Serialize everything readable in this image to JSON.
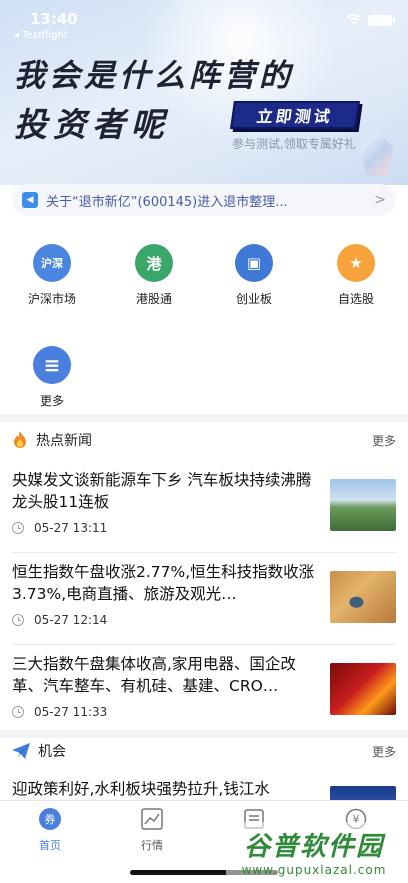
{
  "status_bar": {
    "time": "13:40",
    "back_label": "◂ Testflight"
  },
  "banner": {
    "headline_line1": "我会是什么阵营的",
    "headline_line2": "投资者呢",
    "cta_label": "立即测试",
    "subtitle": "参与测试,领取专属好礼"
  },
  "notice": {
    "text": "关于“退市新亿”(600145)进入退市整理...",
    "arrow": ">"
  },
  "quick_grid": [
    {
      "label": "沪深市场",
      "glyph": "沪深",
      "color": "#4a86e0"
    },
    {
      "label": "港股通",
      "glyph": "港",
      "color": "#3aa66a"
    },
    {
      "label": "创业板",
      "glyph": "▣",
      "color": "#3f78d6"
    },
    {
      "label": "自选股",
      "glyph": "★",
      "color": "#f5a33a"
    },
    {
      "label": "更多",
      "glyph": "≡",
      "color": "#4a7fe0"
    }
  ],
  "hot_news": {
    "title": "热点新闻",
    "more": "更多",
    "items": [
      {
        "title": "央媒发文谈新能源车下乡 汽车板块持续沸腾 龙头股11连板",
        "time": "05-27 13:11"
      },
      {
        "title": "恒生指数午盘收涨2.77%,恒生科技指数收涨3.73%,电商直播、旅游及观光…",
        "time": "05-27 12:14"
      },
      {
        "title": "三大指数午盘集体收高,家用电器、国企改革、汽车整车、有机硅、基建、CRO…",
        "time": "05-27 11:33"
      }
    ]
  },
  "opportunity": {
    "title": "机会",
    "more": "更多",
    "first_item_title": "迎政策利好,水利板块强势拉升,钱江水"
  },
  "tabbar": {
    "tabs": [
      {
        "label": "首页"
      },
      {
        "label": "行情"
      },
      {
        "label": ""
      },
      {
        "label": ""
      }
    ]
  },
  "watermark": {
    "main": "谷普软件园",
    "sub": "www.gupuxlazal.com"
  },
  "colors": {
    "accent": "#4a7fe0",
    "banner_cta": "#1c2b8a",
    "notice_text": "#4a5ba8"
  }
}
